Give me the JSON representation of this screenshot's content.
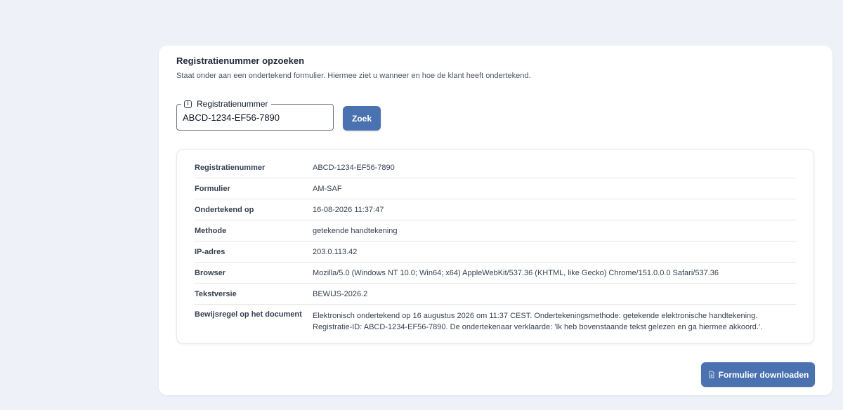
{
  "lookup": {
    "title": "Registratienummer opzoeken",
    "subtitle": "Staat onder aan een ondertekend formulier. Hiermee ziet u wanneer en hoe de klant heeft ondertekend.",
    "field_label": "Registratienummer",
    "field_value": "ABCD-1234-EF56-7890",
    "search_label": "Zoek"
  },
  "details": {
    "rows": [
      {
        "label": "Registratienummer",
        "value": "ABCD-1234-EF56-7890"
      },
      {
        "label": "Formulier",
        "value": "AM-SAF"
      },
      {
        "label": "Ondertekend op",
        "value": "16-08-2026 11:37:47"
      },
      {
        "label": "Methode",
        "value": "getekende handtekening"
      },
      {
        "label": "IP-adres",
        "value": "203.0.113.42"
      },
      {
        "label": "Browser",
        "value": "Mozilla/5.0 (Windows NT 10.0; Win64; x64) AppleWebKit/537.36 (KHTML, like Gecko) Chrome/151.0.0.0 Safari/537.36"
      },
      {
        "label": "Tekstversie",
        "value": "BEWIJS-2026.2"
      },
      {
        "label": "Bewijsregel op het document",
        "value": "Elektronisch ondertekend op 16 augustus 2026 om 11:37 CEST. Ondertekeningsmethode: getekende elektronische handtekening. Registratie-ID: ABCD-1234-EF56-7890. De ondertekenaar verklaarde: 'Ik heb bovenstaande tekst gelezen en ga hiermee akkoord.'."
      }
    ]
  },
  "actions": {
    "download_label": "Formulier downloaden",
    "download_icon": "document-download-icon"
  },
  "colors": {
    "accent": "#4a72b0",
    "background": "#eef2f8"
  }
}
